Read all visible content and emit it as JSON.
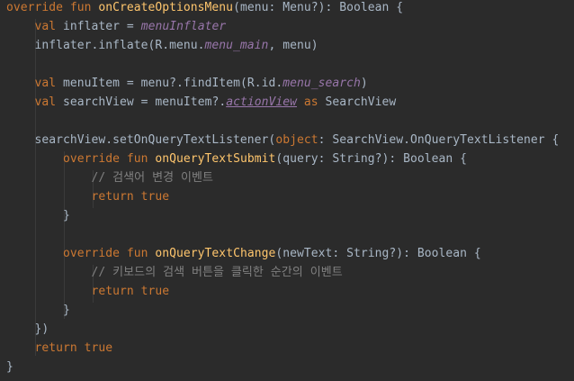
{
  "theme": {
    "background": "#2b2b2b",
    "default_text": "#a9b7c6",
    "keyword": "#cc7832",
    "function": "#ffc66d",
    "property": "#9876aa",
    "comment": "#808080"
  },
  "lines": [
    [
      {
        "t": "kw",
        "v": "override fun "
      },
      {
        "t": "fn",
        "v": "onCreateOptionsMenu"
      },
      {
        "t": "pl",
        "v": "(menu: Menu?): Boolean {"
      }
    ],
    [
      {
        "t": "pl",
        "v": "    "
      },
      {
        "t": "kw",
        "v": "val "
      },
      {
        "t": "pl",
        "v": "inflater = "
      },
      {
        "t": "prop",
        "v": "menuInflater"
      }
    ],
    [
      {
        "t": "pl",
        "v": "    inflater.inflate(R.menu."
      },
      {
        "t": "prop",
        "v": "menu_main"
      },
      {
        "t": "pl",
        "v": ", menu)"
      }
    ],
    [],
    [
      {
        "t": "pl",
        "v": "    "
      },
      {
        "t": "kw",
        "v": "val "
      },
      {
        "t": "pl",
        "v": "menuItem = menu?.findItem(R.id."
      },
      {
        "t": "prop",
        "v": "menu_search"
      },
      {
        "t": "pl",
        "v": ")"
      }
    ],
    [
      {
        "t": "pl",
        "v": "    "
      },
      {
        "t": "kw",
        "v": "val "
      },
      {
        "t": "pl",
        "v": "searchView = menuItem?."
      },
      {
        "t": "ext",
        "v": "actionView"
      },
      {
        "t": "kw",
        "v": " as "
      },
      {
        "t": "pl",
        "v": "SearchView"
      }
    ],
    [],
    [
      {
        "t": "pl",
        "v": "    searchView.setOnQueryTextListener("
      },
      {
        "t": "kw",
        "v": "object"
      },
      {
        "t": "pl",
        "v": ": SearchView.OnQueryTextListener {"
      }
    ],
    [
      {
        "t": "pl",
        "v": "        "
      },
      {
        "t": "kw",
        "v": "override fun "
      },
      {
        "t": "fn",
        "v": "onQueryTextSubmit"
      },
      {
        "t": "pl",
        "v": "(query: String?): Boolean {"
      }
    ],
    [
      {
        "t": "pl",
        "v": "            "
      },
      {
        "t": "cm",
        "v": "// 검색어 변경 이벤트"
      }
    ],
    [
      {
        "t": "pl",
        "v": "            "
      },
      {
        "t": "kw",
        "v": "return true"
      }
    ],
    [
      {
        "t": "pl",
        "v": "        }"
      }
    ],
    [],
    [
      {
        "t": "pl",
        "v": "        "
      },
      {
        "t": "kw",
        "v": "override fun "
      },
      {
        "t": "fn",
        "v": "onQueryTextChange"
      },
      {
        "t": "pl",
        "v": "(newText: String?): Boolean {"
      }
    ],
    [
      {
        "t": "pl",
        "v": "            "
      },
      {
        "t": "cm",
        "v": "// 키보드의 검색 버튼을 클릭한 순간의 이벤트"
      }
    ],
    [
      {
        "t": "pl",
        "v": "            "
      },
      {
        "t": "kw",
        "v": "return true"
      }
    ],
    [
      {
        "t": "pl",
        "v": "        }"
      }
    ],
    [
      {
        "t": "pl",
        "v": "    })"
      }
    ],
    [
      {
        "t": "pl",
        "v": "    "
      },
      {
        "t": "kw",
        "v": "return true"
      }
    ],
    [
      {
        "t": "pl",
        "v": "}"
      }
    ]
  ]
}
